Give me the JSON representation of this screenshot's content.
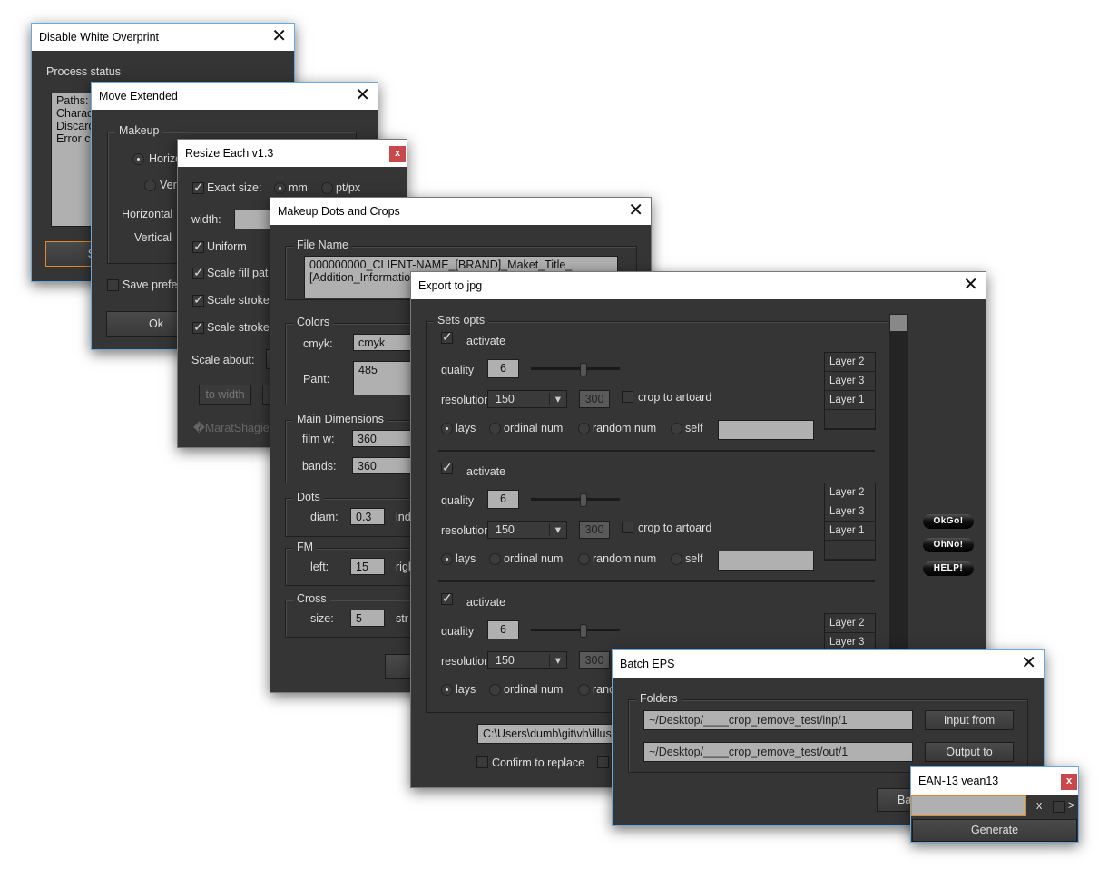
{
  "dwo": {
    "title": "Disable White Overprint",
    "status_label": "Process status",
    "status_lines": [
      "Paths: ",
      "Charact",
      "Discards",
      "Error co"
    ],
    "start": "Start"
  },
  "move": {
    "title": "Move Extended",
    "group": "Makeup",
    "horiz": "Horizo",
    "vert": "Ver",
    "horizontal": "Horizontal",
    "vertical": "Vertical",
    "save": "Save prefe",
    "ok": "Ok"
  },
  "resize": {
    "title": "Resize Each v1.3",
    "close": "x",
    "exact": "Exact size:",
    "mm": "mm",
    "ptpx": "pt/px",
    "width": "width:",
    "uniform": "Uniform",
    "fill": "Scale fill pat",
    "stroke1": "Scale stroke",
    "stroke2": "Scale stroke",
    "about": "Scale about:",
    "to_width": "to width",
    "credit": "�MaratShagiev"
  },
  "mdc": {
    "title": "Makeup Dots and Crops",
    "file_group": "File Name",
    "file_name": "000000000_CLIENT-NAME_[BRAND]_Maket_Title_\n[Addition_Information",
    "colors_group": "Colors",
    "cmyk_label": "cmyk:",
    "cmyk_value": "cmyk",
    "pant_label": "Pant:",
    "pant_value": "485",
    "dims_group": "Main Dimensions",
    "film_label": "film w:",
    "film_value": "360",
    "bands_label": "bands:",
    "bands_value": "360",
    "dots_group": "Dots",
    "diam_label": "diam:",
    "diam_value": "0.3",
    "ind": "ind",
    "fm_group": "FM",
    "left_label": "left:",
    "left_value": "15",
    "right": "righ",
    "cross_group": "Cross",
    "size_label": "size:",
    "size_value": "5",
    "str": "str"
  },
  "jpg": {
    "title": "Export to jpg",
    "group": "Sets opts",
    "sets": [
      {
        "activate": "activate",
        "active": true,
        "quality_label": "quality",
        "quality": "6",
        "quality_slider": 6,
        "res_label": "resolution",
        "res": "150",
        "res2": "300",
        "crop": "crop to artoard",
        "radios": [
          "lays",
          "ordinal num",
          "random num",
          "self"
        ],
        "selected": 0,
        "layers": [
          "Layer 2",
          "Layer 3",
          "Layer 1"
        ]
      },
      {
        "activate": "activate",
        "active": true,
        "quality_label": "quality",
        "quality": "6",
        "quality_slider": 6,
        "res_label": "resolution",
        "res": "150",
        "res2": "300",
        "crop": "crop to artoard",
        "radios": [
          "lays",
          "ordinal num",
          "random num",
          "self"
        ],
        "selected": 0,
        "layers": [
          "Layer 2",
          "Layer 3",
          "Layer 1"
        ]
      },
      {
        "activate": "activate",
        "active": true,
        "quality_label": "quality",
        "quality": "6",
        "quality_slider": 6,
        "res_label": "resolution",
        "res": "150",
        "res2": "300",
        "crop": "",
        "radios": [
          "lays",
          "ordinal num",
          "rand"
        ],
        "selected": 0,
        "layers": [
          "Layer 2",
          "Layer 3"
        ]
      }
    ],
    "okgo": "OkGo!",
    "ohno": "OhNo!",
    "help": "HELP!",
    "path": "C:\\Users\\dumb\\git\\vh\\illust",
    "confirm": "Confirm to replace"
  },
  "batch": {
    "title": "Batch EPS",
    "group": "Folders",
    "input_path": "~/Desktop/____crop_remove_test/inp/1",
    "output_path": "~/Desktop/____crop_remove_test/out/1",
    "input_btn": "Input from",
    "output_btn": "Output to",
    "batch_btn": "Ba"
  },
  "ean": {
    "title": "EAN-13  vean13",
    "close": "x",
    "value": "",
    "x": "x",
    "arrow": ">",
    "generate": "Generate"
  }
}
